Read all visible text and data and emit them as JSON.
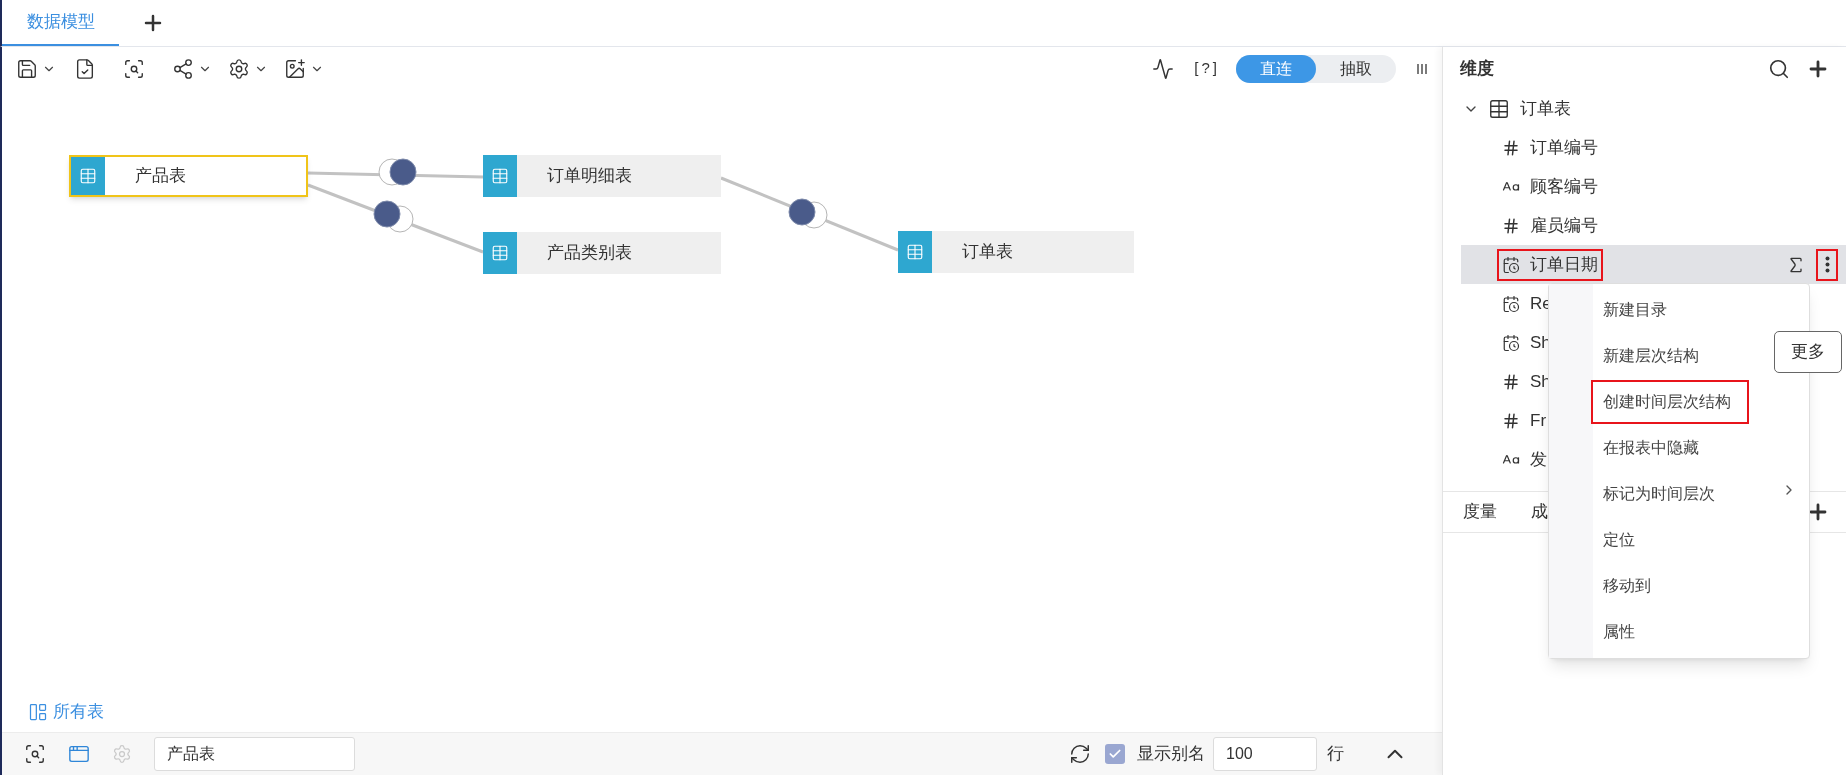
{
  "tabs": [
    {
      "label": "数据模型",
      "selected": true
    }
  ],
  "toolbar": {
    "help": "[?]",
    "mode_toggle": [
      {
        "label": "直连",
        "selected": true
      },
      {
        "label": "抽取",
        "selected": false
      }
    ]
  },
  "canvas": {
    "nodes": [
      {
        "label": "产品表",
        "selected": true
      },
      {
        "label": "订单明细表",
        "selected": false
      },
      {
        "label": "产品类别表",
        "selected": false
      },
      {
        "label": "订单表",
        "selected": false
      }
    ]
  },
  "all_tables_link": "所有表",
  "bottom_bar": {
    "search_value": "产品表",
    "show_alias": {
      "label": "显示别名",
      "checked": true
    },
    "row_count": "100",
    "row_unit": "行"
  },
  "dimensions": {
    "title": "维度",
    "tables": [
      {
        "label": "订单表",
        "expanded": true,
        "children": [
          {
            "label": "订单编号",
            "kind": "number",
            "selected": false,
            "annotated": false
          },
          {
            "label": "顾客编号",
            "kind": "text",
            "selected": false,
            "annotated": false
          },
          {
            "label": "雇员编号",
            "kind": "number",
            "selected": false,
            "annotated": false
          },
          {
            "label": "订单日期",
            "kind": "date",
            "selected": true,
            "annotated": true
          },
          {
            "label": "Re",
            "kind": "date",
            "selected": false,
            "annotated": false
          },
          {
            "label": "Sh",
            "kind": "date",
            "selected": false,
            "annotated": false
          },
          {
            "label": "Sh",
            "kind": "number",
            "selected": false,
            "annotated": false
          },
          {
            "label": "Fr",
            "kind": "number",
            "selected": false,
            "annotated": false
          },
          {
            "label": "发",
            "kind": "text",
            "selected": false,
            "annotated": false
          }
        ]
      }
    ]
  },
  "more_button": {
    "annotated": true
  },
  "measure_tabs": [
    {
      "label": "度量"
    },
    {
      "label": "成"
    }
  ],
  "context_menu": {
    "items": [
      {
        "label": "新建目录",
        "annotated": false
      },
      {
        "label": "新建层次结构",
        "annotated": false
      },
      {
        "label": "创建时间层次结构",
        "annotated": true
      },
      {
        "label": "在报表中隐藏",
        "annotated": false
      },
      {
        "label": "标记为时间层次",
        "submenu": true,
        "annotated": false
      },
      {
        "label": "定位",
        "annotated": false
      },
      {
        "label": "移动到",
        "annotated": false
      },
      {
        "label": "属性",
        "annotated": false
      }
    ]
  },
  "tooltip": "更多"
}
